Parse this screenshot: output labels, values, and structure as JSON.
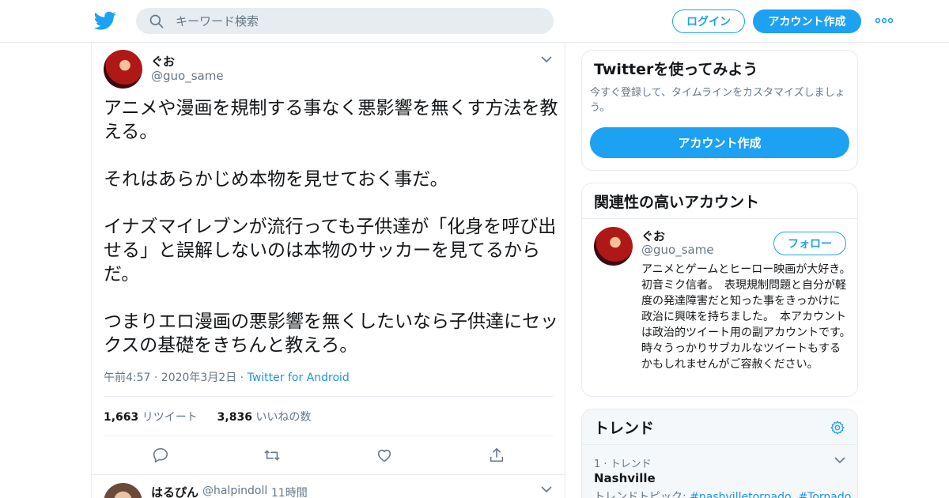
{
  "header": {
    "logo": "twitter-bird-icon",
    "search_placeholder": "キーワード検索",
    "login_label": "ログイン",
    "signup_label": "アカウント作成",
    "more_icon": "more-dots-icon",
    "accent_color": "#1da1f2"
  },
  "tweet": {
    "author_name": "ぐお",
    "author_handle": "@guo_same",
    "paragraphs": [
      "アニメや漫画を規制する事なく悪影響を無くす方法を教える。",
      "それはあらかじめ本物を見せておく事だ。",
      "イナズマイレブンが流行っても子供達が「化身を呼び出せる」と誤解しないのは本物のサッカーを見てるからだ。",
      "つまりエロ漫画の悪影響を無くしたいなら子供達にセックスの基礎をきちんと教えろ。"
    ],
    "timestamp": "午前4:57 · 2020年3月2日",
    "separator": " · ",
    "source": "Twitter for Android",
    "retweet_count": "1,663",
    "retweet_label": "リツイート",
    "like_count": "3,836",
    "like_label": "いいねの数",
    "actions": [
      "reply-icon",
      "retweet-icon",
      "like-icon",
      "share-icon"
    ]
  },
  "reply": {
    "author_name": "はるぴん",
    "author_handle": "@halpindoll",
    "time": "· 11時間"
  },
  "sidebar": {
    "signup_card": {
      "title": "Twitterを使ってみよう",
      "description": "今すぐ登録して、タイムラインをカスタマイズしましょう。",
      "button": "アカウント作成"
    },
    "related_card": {
      "title": "関連性の高いアカウント",
      "name": "ぐお",
      "handle": "@guo_same",
      "follow_label": "フォロー",
      "bio": "アニメとゲームとヒーロー映画が大好き。　初音ミク信者。　表現規制問題と自分が軽度の発達障害だと知った事をきっかけに政治に興味を持ちました。　本アカウントは政治的ツイート用の副アカウントです。　時々うっかりサブカルなツイートもするかもしれませんがご容赦ください。"
    },
    "trends_card": {
      "title": "トレンド",
      "trend_meta": "1 · トレンド",
      "trend_name": "Nashville",
      "topics_prefix": "トレンドトピック:",
      "topics": "#nashvilletornado, #Tornado"
    }
  }
}
